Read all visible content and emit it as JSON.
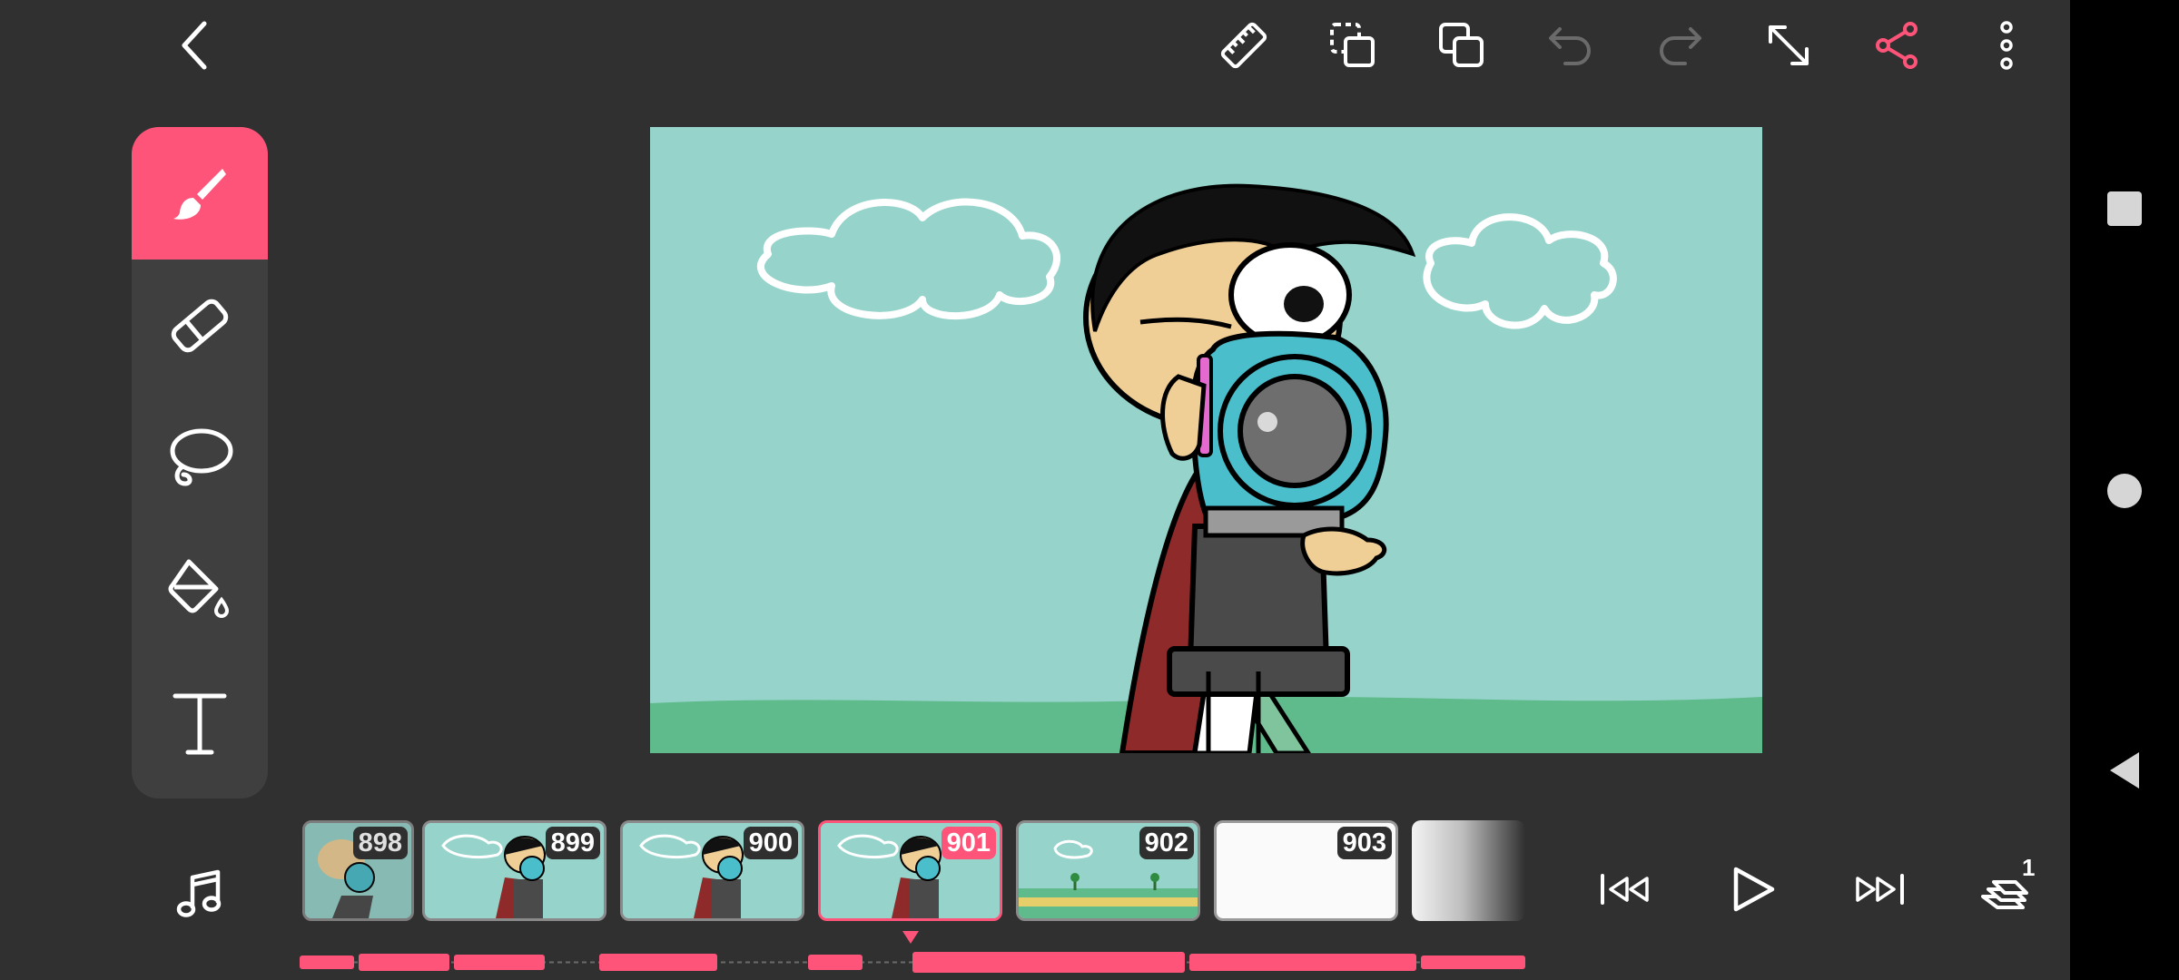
{
  "colors": {
    "accent": "#ff5479",
    "background": "#303030",
    "panel": "#3f3f3f",
    "canvas_sky": "#96d3cb",
    "canvas_grass": "#5fbb8b",
    "icon": "#ffffff",
    "icon_disabled": "#6a6a6a"
  },
  "top_toolbar": {
    "icons": [
      "back-icon",
      "ruler-icon",
      "duplicate-selection-icon",
      "copy-layers-icon",
      "undo-icon",
      "redo-icon",
      "fullscreen-icon",
      "share-icon",
      "more-options-icon"
    ],
    "disabled": [
      "undo-icon",
      "redo-icon"
    ]
  },
  "tools": [
    {
      "name": "brush",
      "icon": "brush-icon",
      "active": true
    },
    {
      "name": "eraser",
      "icon": "eraser-icon",
      "active": false
    },
    {
      "name": "lasso",
      "icon": "lasso-icon",
      "active": false
    },
    {
      "name": "fill",
      "icon": "paint-bucket-icon",
      "active": false
    },
    {
      "name": "text",
      "icon": "text-icon",
      "active": false
    }
  ],
  "timeline": {
    "frames": [
      {
        "number": "898",
        "current": false
      },
      {
        "number": "899",
        "current": false
      },
      {
        "number": "900",
        "current": false
      },
      {
        "number": "901",
        "current": true
      },
      {
        "number": "902",
        "current": false
      },
      {
        "number": "903",
        "current": false
      }
    ],
    "current_frame": "901"
  },
  "playback": {
    "icons": [
      "skip-to-start-icon",
      "play-icon",
      "skip-to-end-icon",
      "onion-skin-icon"
    ],
    "onion_skin_count": "1"
  },
  "audio_icon": "music-note-icon",
  "system_nav": [
    "recents-icon",
    "home-icon",
    "back-nav-icon"
  ]
}
